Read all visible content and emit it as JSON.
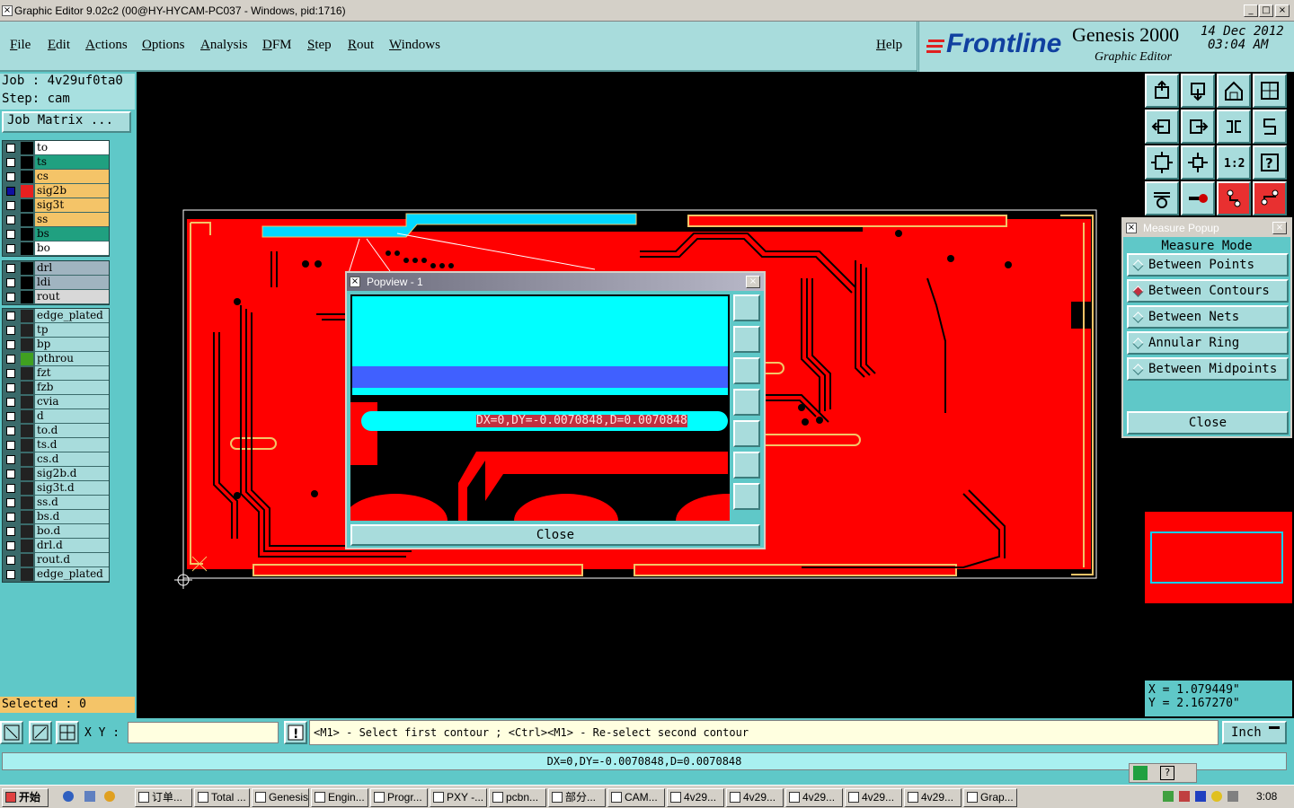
{
  "window": {
    "title": "Graphic Editor 9.02c2 (00@HY-HYCAM-PC037 - Windows, pid:1716)",
    "controls": [
      "_",
      "□",
      "×"
    ]
  },
  "menu": {
    "items": [
      "File",
      "Edit",
      "Actions",
      "Options",
      "Analysis",
      "DFM",
      "Step",
      "Rout",
      "Windows"
    ],
    "help": "Help"
  },
  "brand": {
    "logo": "Frontline",
    "product": "Genesis 2000",
    "subtitle": "Graphic Editor",
    "date": "14 Dec 2012",
    "time": "03:04 AM"
  },
  "job": {
    "job_label": "Job : 4v29uf0ta0",
    "step_label": "Step: cam",
    "matrix_button": "Job Matrix ..."
  },
  "layers": {
    "group1": [
      {
        "name": "to",
        "color": "#ffffff",
        "swatch": "",
        "active": false
      },
      {
        "name": "ts",
        "color": "#20a080",
        "swatch": "",
        "active": false
      },
      {
        "name": "cs",
        "color": "#f4c468",
        "swatch": "",
        "active": false
      },
      {
        "name": "sig2b",
        "color": "#f4c468",
        "swatch": "#e82020",
        "active": true
      },
      {
        "name": "sig3t",
        "color": "#f4c468",
        "swatch": "",
        "active": false
      },
      {
        "name": "ss",
        "color": "#f4c468",
        "swatch": "",
        "active": false
      },
      {
        "name": "bs",
        "color": "#20a080",
        "swatch": "",
        "active": false
      },
      {
        "name": "bo",
        "color": "#ffffff",
        "swatch": "",
        "active": false
      }
    ],
    "group2": [
      {
        "name": "drl",
        "color": "#a0b4c0"
      },
      {
        "name": "ldi",
        "color": "#a0b4c0"
      },
      {
        "name": "rout",
        "color": "#d8d8d8"
      }
    ],
    "group3": [
      {
        "name": "edge_plated",
        "swatch": ""
      },
      {
        "name": "tp",
        "swatch": ""
      },
      {
        "name": "bp",
        "swatch": ""
      },
      {
        "name": "pthrou",
        "swatch": "#40a020"
      },
      {
        "name": "fzt",
        "swatch": ""
      },
      {
        "name": "fzb",
        "swatch": ""
      },
      {
        "name": "cvia",
        "swatch": ""
      },
      {
        "name": "d",
        "swatch": ""
      },
      {
        "name": "to.d",
        "swatch": ""
      },
      {
        "name": "ts.d",
        "swatch": ""
      },
      {
        "name": "cs.d",
        "swatch": ""
      },
      {
        "name": "sig2b.d",
        "swatch": ""
      },
      {
        "name": "sig3t.d",
        "swatch": ""
      },
      {
        "name": "ss.d",
        "swatch": ""
      },
      {
        "name": "bs.d",
        "swatch": ""
      },
      {
        "name": "bo.d",
        "swatch": ""
      },
      {
        "name": "drl.d",
        "swatch": ""
      },
      {
        "name": "rout.d",
        "swatch": ""
      },
      {
        "name": "edge_plated",
        "swatch": ""
      }
    ],
    "selected_label": "Selected : 0"
  },
  "measure": {
    "title": "Measure Popup",
    "mode_label": "Measure Mode",
    "options": [
      {
        "label": "Between Points",
        "selected": false
      },
      {
        "label": "Between Contours",
        "selected": true
      },
      {
        "label": "Between Nets",
        "selected": false
      },
      {
        "label": "Annular Ring",
        "selected": false
      },
      {
        "label": "Between Midpoints",
        "selected": false
      }
    ],
    "close": "Close"
  },
  "popview": {
    "title": "Popview - 1",
    "measurement": "DX=0,DY=-0.0070848,D=0.0070848",
    "close": "Close"
  },
  "coords": {
    "x": "X = 1.079449\"",
    "y": "Y = 2.167270\""
  },
  "prompt": {
    "xy_label": "X Y :",
    "xy_value": "",
    "message": "<M1> - Select first contour ; <Ctrl><M1> - Re-select second contour",
    "units": "Inch"
  },
  "status": {
    "text": "DX=0,DY=-0.0070848,D=0.0070848"
  },
  "taskbar": {
    "start": "开始",
    "tasks": [
      "订单...",
      "Total ...",
      "Genesis",
      "Engin...",
      "Progr...",
      "PXY -...",
      "pcbn...",
      "部分...",
      "CAM...",
      "4v29...",
      "4v29...",
      "4v29...",
      "4v29...",
      "4v29...",
      "Grap..."
    ],
    "clock": "3:08"
  },
  "colors": {
    "panel": "#5fc8c8",
    "button": "#a8dcdc",
    "board": "#ff0000",
    "highlight": "#00ffff",
    "accent_yellow": "#f4c468"
  }
}
